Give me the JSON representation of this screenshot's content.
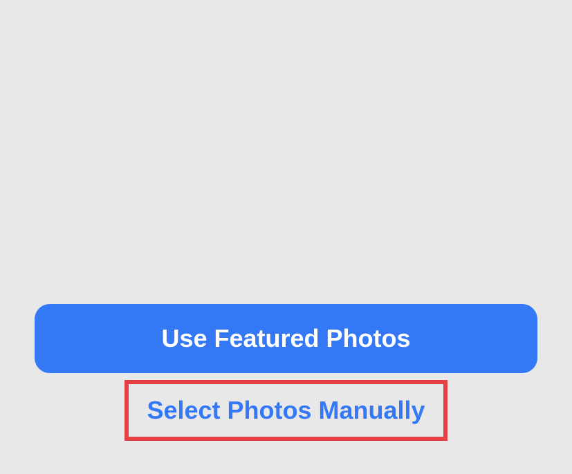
{
  "buttons": {
    "primary_label": "Use Featured Photos",
    "secondary_label": "Select Photos Manually"
  },
  "colors": {
    "primary_button_bg": "#3478f6",
    "primary_button_text": "#ffffff",
    "secondary_button_text": "#3478f6",
    "highlight_border": "#e54043",
    "background": "#e8e8e8"
  }
}
